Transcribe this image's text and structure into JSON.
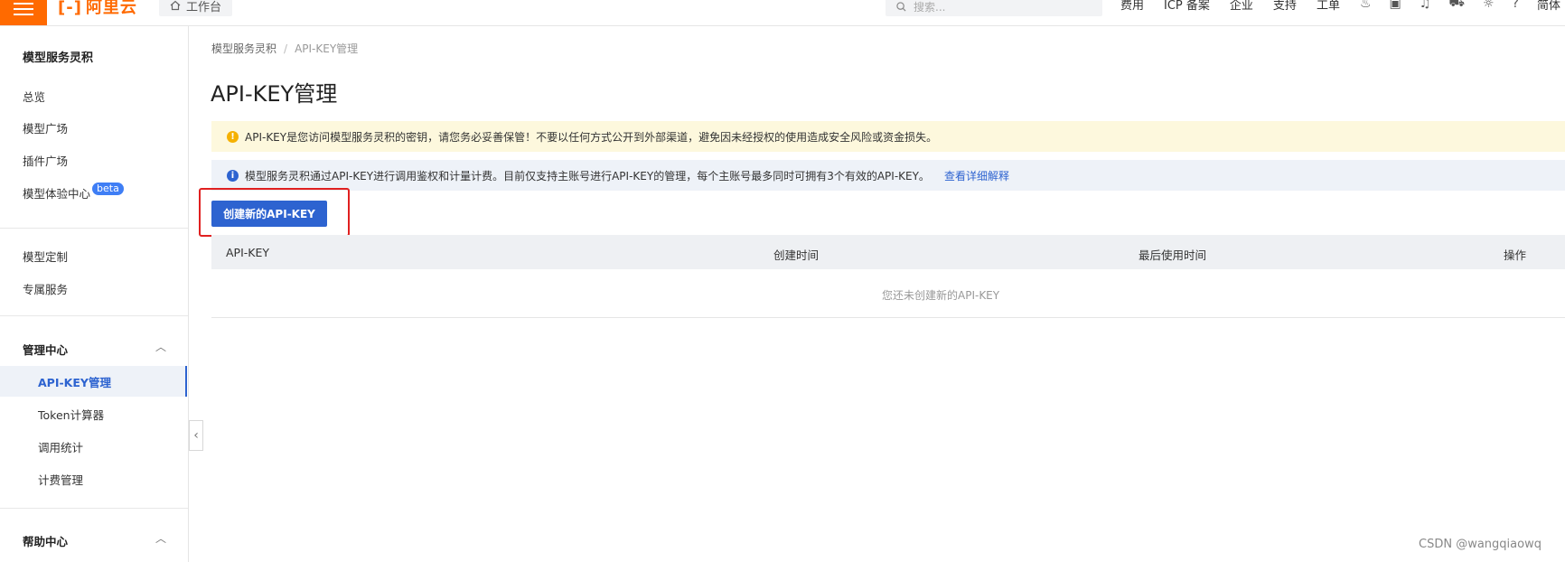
{
  "topbar": {
    "logo_text": "阿里云",
    "workbench_label": "工作台",
    "search_placeholder": "搜索...",
    "nav": [
      "费用",
      "ICP 备案",
      "企业",
      "支持",
      "工单"
    ],
    "user_label": "简体",
    "brand_color": "#ff6a00"
  },
  "sidebar": {
    "title": "模型服务灵积",
    "items": [
      {
        "label": "总览"
      },
      {
        "label": "模型广场"
      },
      {
        "label": "插件广场"
      },
      {
        "label": "模型体验中心",
        "badge": "beta"
      },
      {
        "label": "模型定制"
      },
      {
        "label": "专属服务"
      }
    ],
    "groups": [
      {
        "label": "管理中心",
        "items": [
          {
            "label": "API-KEY管理",
            "active": true
          },
          {
            "label": "Token计算器"
          },
          {
            "label": "调用统计"
          },
          {
            "label": "计费管理"
          }
        ]
      },
      {
        "label": "帮助中心"
      }
    ]
  },
  "breadcrumb": {
    "root": "模型服务灵积",
    "separator": "/",
    "current": "API-KEY管理"
  },
  "page": {
    "title": "API-KEY管理",
    "warning_text": "API-KEY是您访问模型服务灵积的密钥，请您务必妥善保管！不要以任何方式公开到外部渠道，避免因未经授权的使用造成安全风险或资金损失。",
    "info_text": "模型服务灵积通过API-KEY进行调用鉴权和计量计费。目前仅支持主账号进行API-KEY的管理，每个主账号最多同时可拥有3个有效的API-KEY。",
    "info_link": "查看详细解释",
    "create_button": "创建新的API-KEY",
    "accent_color": "#2d63d0"
  },
  "table": {
    "columns": [
      "API-KEY",
      "创建时间",
      "最后使用时间",
      "操作"
    ],
    "rows": [],
    "empty_text": "您还未创建新的API-KEY"
  },
  "watermark": "CSDN @wangqiaowq"
}
